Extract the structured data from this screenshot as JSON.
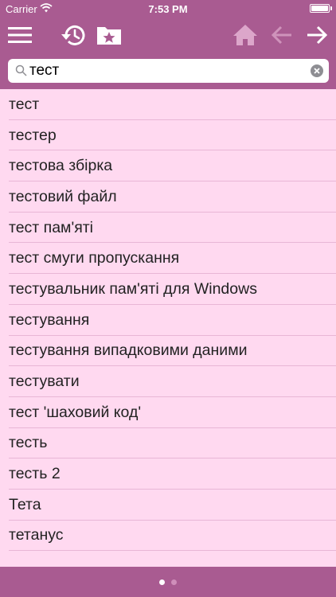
{
  "status_bar": {
    "carrier": "Carrier",
    "time": "7:53 PM"
  },
  "toolbar": {
    "icons": [
      "menu-icon",
      "history-icon",
      "favorites-folder-icon",
      "home-icon",
      "back-arrow-icon",
      "forward-arrow-icon"
    ]
  },
  "search": {
    "value": "тест"
  },
  "results": [
    "тест",
    "тестер",
    "тестова збірка",
    "тестовий файл",
    "тест пам'яті",
    "тест смуги пропускання",
    "тестувальник пам'яті для Windows",
    "тестування",
    "тестування випадковими даними",
    "тестувати",
    "тест 'шаховий код'",
    "тесть",
    "тесть 2",
    "Тета",
    "тетанус"
  ],
  "colors": {
    "bar": "#a95b91",
    "list_bg": "#ffd9f0",
    "separator": "#e8b6d6"
  },
  "page_indicator": {
    "pages": 2,
    "current": 1
  }
}
